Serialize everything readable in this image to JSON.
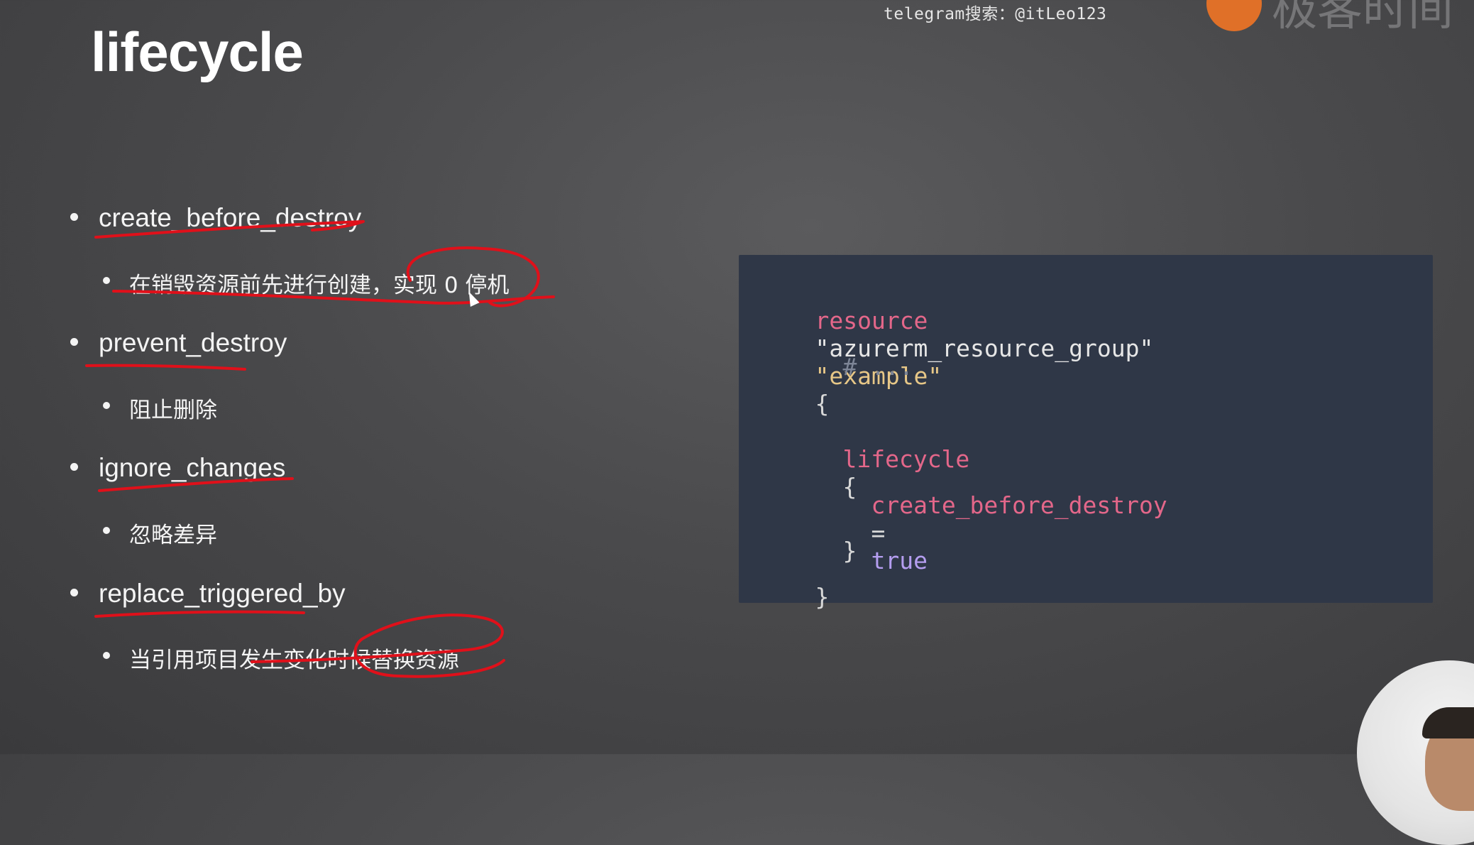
{
  "watermark": "telegram搜索：@itLeo123",
  "logo_text": "极客时间",
  "title": "lifecycle",
  "items": [
    {
      "label": "create_before_destroy",
      "sub": "在销毁资源前先进行创建，实现 0 停机"
    },
    {
      "label": "prevent_destroy",
      "sub": "阻止删除"
    },
    {
      "label": "ignore_changes",
      "sub": "忽略差异"
    },
    {
      "label": "replace_triggered_by",
      "sub": "当引用项目发生变化时候替换资源"
    }
  ],
  "code": {
    "line1_kw": "resource",
    "line1_type": "\"azurerm_resource_group\"",
    "line1_name": "\"example\"",
    "line1_brace": "{",
    "line2_comment": "# ...",
    "line3_block": "lifecycle",
    "line3_brace": "{",
    "line4_attr": "create_before_destroy",
    "line4_eq": "=",
    "line4_val": "true",
    "line5_close": "}",
    "line6_close": "}"
  },
  "colors": {
    "keyword": "#e4678a",
    "string": "#e7c787",
    "boolean": "#b59ef0",
    "code_bg": "#2f3747",
    "annotation": "#e0101a"
  }
}
